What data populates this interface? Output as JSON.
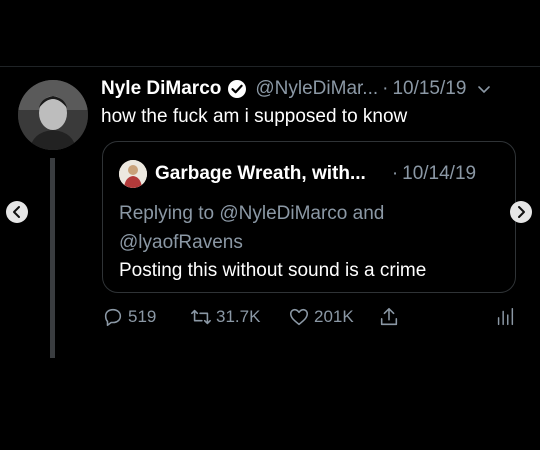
{
  "tweet": {
    "author_name": "Nyle DiMarco",
    "handle": "@NyleDiMar...",
    "separator": "·",
    "date": "10/15/19",
    "text": "how the fuck am i supposed to know"
  },
  "quoted_tweet": {
    "author_name": "Garbage Wreath, with...",
    "separator": "·",
    "date": "10/14/19",
    "replying_line1": "Replying to @NyleDiMarco and",
    "replying_line2": "@lyaofRavens",
    "text": "Posting this without sound is a crime"
  },
  "actions": {
    "replies": "519",
    "retweets": "31.7K",
    "likes": "201K"
  },
  "icons": {
    "verified": "verified-badge-icon",
    "more": "chevron-down-icon",
    "reply": "reply-icon",
    "retweet": "retweet-icon",
    "like": "heart-icon",
    "share": "share-icon",
    "analytics": "analytics-icon",
    "prev": "chevron-left-icon",
    "next": "chevron-right-icon"
  },
  "colors": {
    "background": "#000000",
    "primary_text": "#ffffff",
    "secondary_text": "#8b98a5",
    "border": "#2f3336"
  }
}
